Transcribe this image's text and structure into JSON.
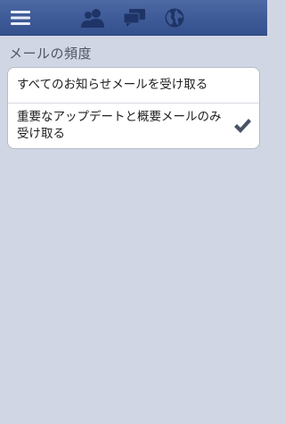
{
  "navbar": {
    "icons": {
      "menu": "menu-icon",
      "friends": "friend-requests-icon",
      "messages": "messages-icon",
      "notifications": "globe-notifications-icon"
    },
    "colors": {
      "bar": "#3f5b98",
      "icon_active": "#e8edf6",
      "icon_inactive": "#1f3466"
    }
  },
  "page": {
    "section_title": "メールの頻度"
  },
  "options": [
    {
      "label": "すべてのお知らせメールを受け取る",
      "selected": false
    },
    {
      "label": "重要なアップデートと概要メールのみ受け取る",
      "selected": true
    }
  ]
}
